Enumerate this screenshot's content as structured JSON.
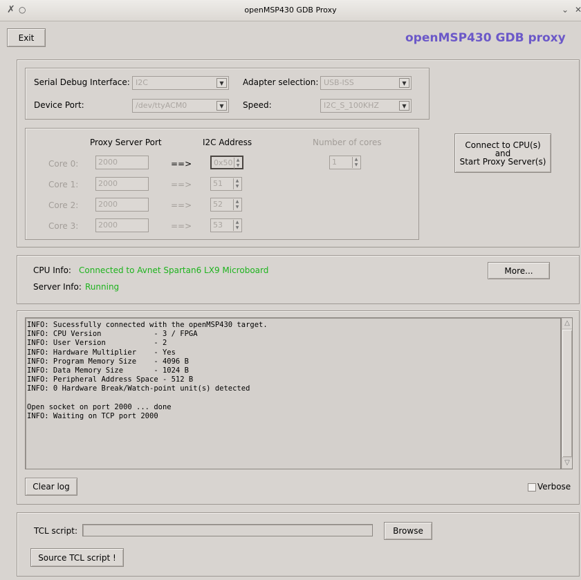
{
  "window": {
    "title": "openMSP430 GDB Proxy"
  },
  "header": {
    "exit_label": "Exit",
    "app_title": "openMSP430 GDB proxy"
  },
  "colors": {
    "title_accent": "#6b58c8",
    "status_green": "#1db31d"
  },
  "interface": {
    "serial_label": "Serial Debug Interface:",
    "serial_value": "I2C",
    "adapter_label": "Adapter selection:",
    "adapter_value": "USB-ISS",
    "port_label": "Device Port:",
    "port_value": "/dev/ttyACM0",
    "speed_label": "Speed:",
    "speed_value": "I2C_S_100KHZ"
  },
  "cores": {
    "header_port": "Proxy Server Port",
    "header_addr": "I2C Address",
    "header_num": "Number of cores",
    "arrow": "==>",
    "num_cores_value": "1",
    "rows": [
      {
        "label": "Core 0:",
        "port": "2000",
        "addr": "0x50"
      },
      {
        "label": "Core 1:",
        "port": "2000",
        "addr": "51"
      },
      {
        "label": "Core 2:",
        "port": "2000",
        "addr": "52"
      },
      {
        "label": "Core 3:",
        "port": "2000",
        "addr": "53"
      }
    ]
  },
  "connect": {
    "line1": "Connect to CPU(s)",
    "line2": "and",
    "line3": "Start Proxy Server(s)"
  },
  "info": {
    "cpu_label": "CPU Info:",
    "cpu_value": "Connected to Avnet Spartan6 LX9 Microboard",
    "server_label": "Server Info:",
    "server_value": "Running",
    "more_label": "More..."
  },
  "log": {
    "lines": [
      "INFO: Sucessfully connected with the openMSP430 target.",
      "INFO: CPU Version            - 3 / FPGA",
      "INFO: User Version           - 2",
      "INFO: Hardware Multiplier    - Yes",
      "INFO: Program Memory Size    - 4096 B",
      "INFO: Data Memory Size       - 1024 B",
      "INFO: Peripheral Address Space - 512 B",
      "INFO: 0 Hardware Break/Watch-point unit(s) detected",
      "",
      "Open socket on port 2000 ... done",
      "INFO: Waiting on TCP port 2000"
    ],
    "clear_label": "Clear log",
    "verbose_label": "Verbose"
  },
  "tcl": {
    "label": "TCL script:",
    "value": "",
    "browse_label": "Browse",
    "source_label": "Source TCL script !"
  }
}
